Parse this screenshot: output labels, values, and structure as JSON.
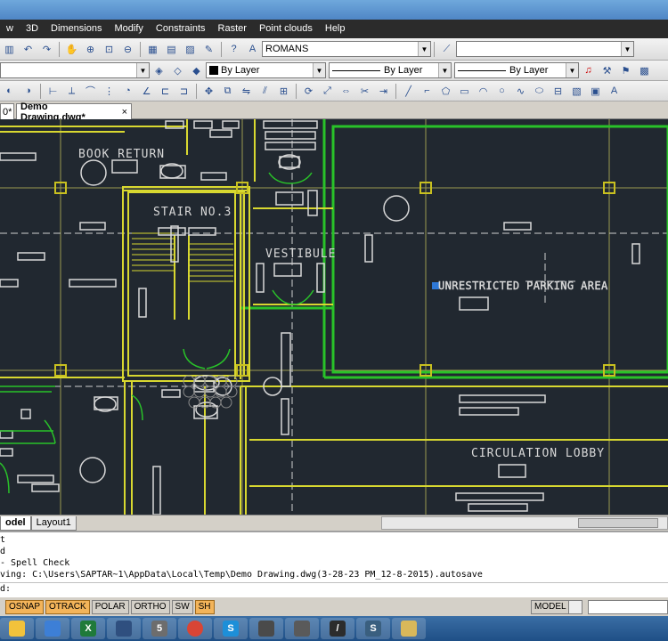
{
  "menu": {
    "items": [
      "w",
      "3D",
      "Dimensions",
      "Modify",
      "Constraints",
      "Raster",
      "Point clouds",
      "Help"
    ]
  },
  "toolbar1": {
    "text_style": "ROMANS"
  },
  "toolbar2": {
    "color": "By Layer",
    "linetype": "By Layer",
    "lineweight": "By Layer"
  },
  "doc_tabs": {
    "prev_label": "0*",
    "active_tab": "Demo Drawing.dwg*",
    "close_glyph": "×"
  },
  "drawing": {
    "labels": {
      "book_return": "BOOK RETURN",
      "stair": "STAIR NO.3",
      "vestibule": "VESTIBULE",
      "parking": "UNRESTRICTED PARKING AREA",
      "circulation": "CIRCULATION LOBBY"
    },
    "colors": {
      "background": "#212830",
      "wall": "#d8d830",
      "green": "#29c229",
      "white": "#d8d8d8",
      "grid": "#9a9a50",
      "column": "#c8c020"
    }
  },
  "layout_tabs": [
    "odel",
    "Layout1"
  ],
  "command": {
    "lines": [
      "t",
      "d",
      "- Spell Check",
      "ving: C:\\Users\\SAPTAR~1\\AppData\\Local\\Temp\\Demo Drawing.dwg(3-28-23 PM_12-8-2015).autosave"
    ],
    "prompt": "d:"
  },
  "status": {
    "toggles": [
      {
        "label": "OSNAP",
        "on": true
      },
      {
        "label": "OTRACK",
        "on": true
      },
      {
        "label": "POLAR",
        "on": false
      },
      {
        "label": "ORTHO",
        "on": false
      },
      {
        "label": "SW",
        "on": false
      },
      {
        "label": "SH",
        "on": true
      }
    ],
    "model_label": "MODEL"
  },
  "taskbar": {
    "apps": [
      {
        "name": "folder-icon",
        "glyph": "",
        "color": "#f2c23b"
      },
      {
        "name": "tools-icon",
        "glyph": "",
        "color": "#3d7fd6"
      },
      {
        "name": "excel-icon",
        "glyph": "X",
        "color": "#1f7a3a"
      },
      {
        "name": "wildedit-icon",
        "glyph": "",
        "color": "#2f4f7f"
      },
      {
        "name": "s-app-icon",
        "glyph": "5",
        "color": "#6d6d6d"
      },
      {
        "name": "chrome-icon",
        "glyph": "",
        "color": "#d94535"
      },
      {
        "name": "skype-icon",
        "glyph": "S",
        "color": "#1d8fd8"
      },
      {
        "name": "media-icon",
        "glyph": "",
        "color": "#4a4a4a"
      },
      {
        "name": "blank-icon",
        "glyph": "",
        "color": "#5a5a5a"
      },
      {
        "name": "cad-icon",
        "glyph": "/",
        "color": "#2c2c2c"
      },
      {
        "name": "sweet-icon",
        "glyph": "S",
        "color": "#3a5f7f"
      },
      {
        "name": "explorer-icon",
        "glyph": "",
        "color": "#d9b85a"
      }
    ]
  }
}
